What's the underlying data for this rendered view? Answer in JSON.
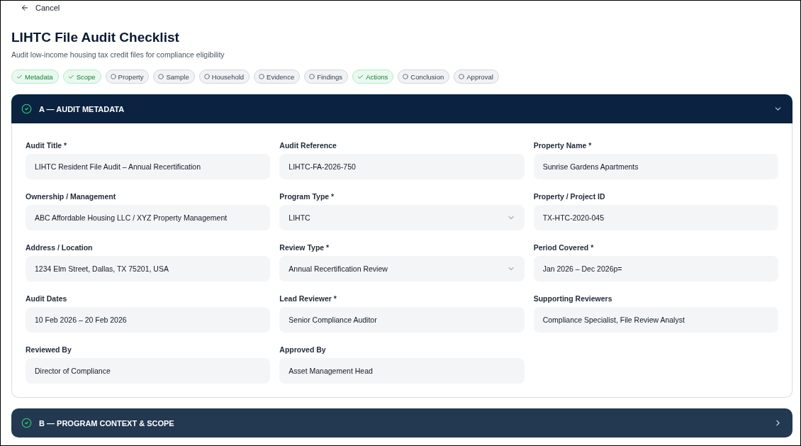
{
  "header": {
    "back_label": "Cancel",
    "title": "LIHTC File Audit Checklist",
    "subtitle": "Audit low-income housing tax credit files for compliance eligibility"
  },
  "steps": [
    {
      "label": "Metadata",
      "done": true
    },
    {
      "label": "Scope",
      "done": true
    },
    {
      "label": "Property",
      "done": false
    },
    {
      "label": "Sample",
      "done": false
    },
    {
      "label": "Household",
      "done": false
    },
    {
      "label": "Evidence",
      "done": false
    },
    {
      "label": "Findings",
      "done": false
    },
    {
      "label": "Actions",
      "done": true
    },
    {
      "label": "Conclusion",
      "done": false
    },
    {
      "label": "Approval",
      "done": false
    }
  ],
  "sections": [
    {
      "title": "A — AUDIT METADATA",
      "complete": true,
      "expanded": true,
      "fields": [
        {
          "kind": "text",
          "label": "Audit Title *",
          "value": "LIHTC Resident File Audit – Annual Recertification"
        },
        {
          "kind": "text",
          "label": "Audit Reference",
          "value": "LIHTC-FA-2026-750"
        },
        {
          "kind": "text",
          "label": "Property Name *",
          "value": "Sunrise Gardens Apartments"
        },
        {
          "kind": "text",
          "label": "Ownership / Management",
          "value": "ABC Affordable Housing LLC / XYZ Property Management"
        },
        {
          "kind": "select",
          "label": "Program Type *",
          "value": "LIHTC"
        },
        {
          "kind": "text",
          "label": "Property / Project ID",
          "value": "TX-HTC-2020-045"
        },
        {
          "kind": "text",
          "label": "Address / Location",
          "value": "1234 Elm Street, Dallas, TX 75201, USA"
        },
        {
          "kind": "select",
          "label": "Review Type *",
          "value": "Annual Recertification Review"
        },
        {
          "kind": "text",
          "label": "Period Covered *",
          "value": "Jan 2026 – Dec 2026p="
        },
        {
          "kind": "text",
          "label": "Audit Dates",
          "value": "10 Feb 2026 – 20 Feb 2026"
        },
        {
          "kind": "text",
          "label": "Lead Reviewer *",
          "value": "Senior Compliance Auditor"
        },
        {
          "kind": "text",
          "label": "Supporting Reviewers",
          "value": "Compliance Specialist, File Review Analyst"
        },
        {
          "kind": "text",
          "label": "Reviewed By",
          "value": "Director of Compliance"
        },
        {
          "kind": "text",
          "label": "Approved By",
          "value": "Asset Management Head"
        }
      ]
    },
    {
      "title": "B — PROGRAM CONTEXT & SCOPE",
      "complete": true,
      "expanded": false
    }
  ]
}
